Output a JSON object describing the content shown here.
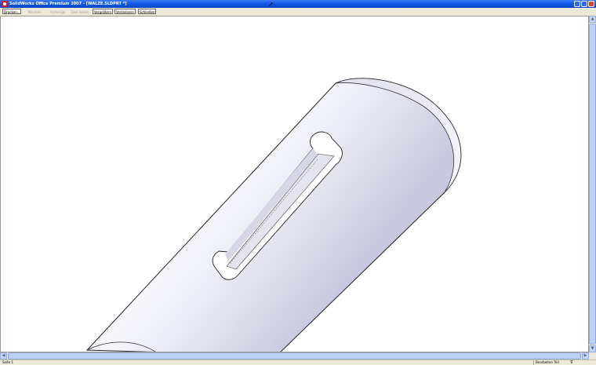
{
  "window": {
    "title": "SolidWorks Office Premium 2007 - [WALZE.SLDPRT *]",
    "controls": [
      "minimize",
      "maximize",
      "close"
    ]
  },
  "toolbar": {
    "buttons": [
      {
        "label": "Drucken...",
        "enabled": true
      },
      {
        "label": "Nächste",
        "enabled": false
      },
      {
        "label": "Vorherige",
        "enabled": false
      },
      {
        "label": "Zwei Seiten",
        "enabled": false
      },
      {
        "label": "Vergrößern",
        "enabled": true
      },
      {
        "label": "Verkleinern",
        "enabled": true
      },
      {
        "label": "Schließen",
        "enabled": true
      }
    ]
  },
  "viewport": {
    "content": "3D shaft with keyway slot (print preview)",
    "colors": {
      "background": "#ffffff",
      "model": "#e6e6f2",
      "edge": "#000000"
    }
  },
  "statusbar": {
    "page": "Seite 1",
    "mode": "Bearbeiten Teil",
    "icon": "filter-icon"
  }
}
